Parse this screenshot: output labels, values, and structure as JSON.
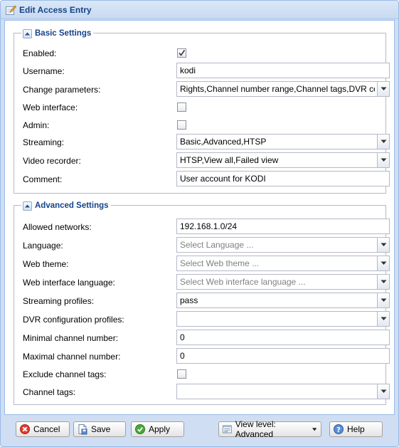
{
  "window": {
    "title": "Edit Access Entry"
  },
  "basic": {
    "legend": "Basic Settings",
    "enabled_label": "Enabled:",
    "enabled_checked": true,
    "username_label": "Username:",
    "username_value": "kodi",
    "change_params_label": "Change parameters:",
    "change_params_value": "Rights,Channel number range,Channel tags,DVR config",
    "web_interface_label": "Web interface:",
    "web_interface_checked": false,
    "admin_label": "Admin:",
    "admin_checked": false,
    "streaming_label": "Streaming:",
    "streaming_value": "Basic,Advanced,HTSP",
    "video_recorder_label": "Video recorder:",
    "video_recorder_value": "HTSP,View all,Failed view",
    "comment_label": "Comment:",
    "comment_value": "User account for KODI"
  },
  "advanced": {
    "legend": "Advanced Settings",
    "allowed_networks_label": "Allowed networks:",
    "allowed_networks_value": "192.168.1.0/24",
    "language_label": "Language:",
    "language_placeholder": "Select Language ...",
    "web_theme_label": "Web theme:",
    "web_theme_placeholder": "Select Web theme ...",
    "web_ui_language_label": "Web interface language:",
    "web_ui_language_placeholder": "Select Web interface language ...",
    "streaming_profiles_label": "Streaming profiles:",
    "streaming_profiles_value": "pass",
    "dvr_profiles_label": "DVR configuration profiles:",
    "dvr_profiles_value": "",
    "min_channel_label": "Minimal channel number:",
    "min_channel_value": "0",
    "max_channel_label": "Maximal channel number:",
    "max_channel_value": "0",
    "exclude_tags_label": "Exclude channel tags:",
    "exclude_tags_checked": false,
    "channel_tags_label": "Channel tags:",
    "channel_tags_value": ""
  },
  "buttons": {
    "cancel": "Cancel",
    "save": "Save",
    "apply": "Apply",
    "view_level": "View level: Advanced",
    "help": "Help"
  },
  "colors": {
    "title_text": "#15428b",
    "frame": "#cfdef2",
    "border": "#99bbe8"
  }
}
